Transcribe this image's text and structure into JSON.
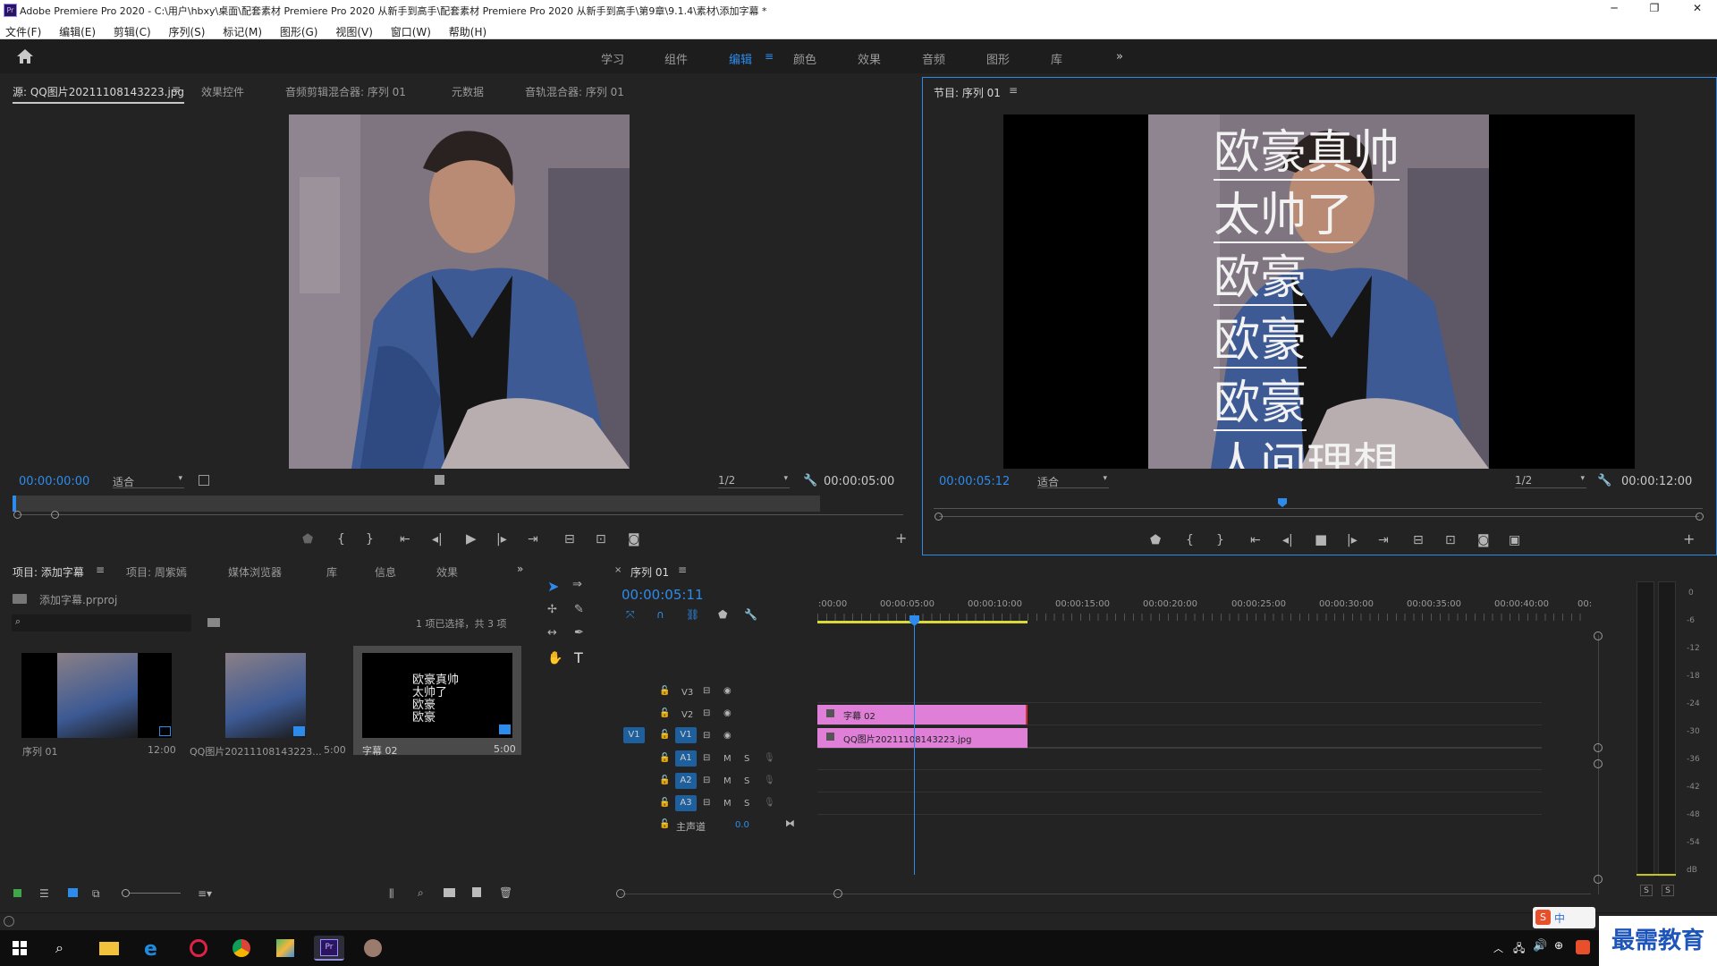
{
  "window": {
    "title": "Adobe Premiere Pro 2020 - C:\\用户\\hbxy\\桌面\\配套素材 Premiere Pro 2020 从新手到高手\\配套素材 Premiere Pro 2020 从新手到高手\\第9章\\9.1.4\\素材\\添加字幕 *",
    "controls": {
      "minimize": "─",
      "restore": "❐",
      "close": "✕"
    }
  },
  "menu": [
    "文件(F)",
    "编辑(E)",
    "剪辑(C)",
    "序列(S)",
    "标记(M)",
    "图形(G)",
    "视图(V)",
    "窗口(W)",
    "帮助(H)"
  ],
  "workspaces": {
    "items": [
      "学习",
      "组件",
      "编辑",
      "颜色",
      "效果",
      "音频",
      "图形",
      "库"
    ],
    "active": "编辑",
    "more": "»"
  },
  "source_panel": {
    "tabs": [
      "源: QQ图片20211108143223.jpg",
      "效果控件",
      "音频剪辑混合器: 序列 01",
      "元数据",
      "音轨混合器: 序列 01"
    ],
    "timecode": "00:00:00:00",
    "fit": "适合",
    "resolution": "1/2",
    "duration": "00:00:05:00"
  },
  "program_panel": {
    "tab": "节目: 序列 01",
    "timecode": "00:00:05:12",
    "fit": "适合",
    "resolution": "1/2",
    "duration": "00:00:12:00",
    "captions": [
      "欧豪真帅",
      "太帅了",
      "欧豪",
      "欧豪",
      "欧豪",
      "人间理想"
    ]
  },
  "project_panel": {
    "tabs": [
      "项目: 添加字幕",
      "项目: 周紫嫣",
      "媒体浏览器",
      "库",
      "信息",
      "效果"
    ],
    "file": "添加字幕.prproj",
    "search_placeholder": "",
    "selection_info": "1 项已选择，共 3 项",
    "items": [
      {
        "name": "序列 01",
        "duration": "12:00"
      },
      {
        "name": "QQ图片20211108143223...",
        "duration": "5:00"
      },
      {
        "name": "字幕 02",
        "duration": "5:00",
        "thumb_text": [
          "欧豪真帅",
          "太帅了",
          "欧豪",
          "欧豪"
        ]
      }
    ]
  },
  "timeline": {
    "tab": "序列 01",
    "timecode": "00:00:05:11",
    "ruler": [
      ":00:00",
      "00:00:05:00",
      "00:00:10:00",
      "00:00:15:00",
      "00:00:20:00",
      "00:00:25:00",
      "00:00:30:00",
      "00:00:35:00",
      "00:00:40:00",
      "00:"
    ],
    "video_tracks": [
      "V3",
      "V2",
      "V1"
    ],
    "audio_tracks": [
      "A1",
      "A2",
      "A3"
    ],
    "source_patch": "V1",
    "audio_buttons": {
      "mute": "M",
      "solo": "S"
    },
    "master": {
      "label": "主声道",
      "value": "0.0"
    },
    "clips": [
      {
        "track": "V2",
        "label": "字幕 02"
      },
      {
        "track": "V1",
        "label": "QQ图片20211108143223.jpg"
      }
    ]
  },
  "audio_meter": {
    "scale": [
      "0",
      "-6",
      "-12",
      "-18",
      "-24",
      "-30",
      "-36",
      "-42",
      "-48",
      "-54",
      "dB"
    ],
    "solo": [
      "S",
      "S"
    ]
  },
  "ime": {
    "label": "中"
  },
  "watermark": "最需教育",
  "colors": {
    "accent": "#2d8ceb",
    "clip": "#e07fd8",
    "bg": "#232323"
  }
}
